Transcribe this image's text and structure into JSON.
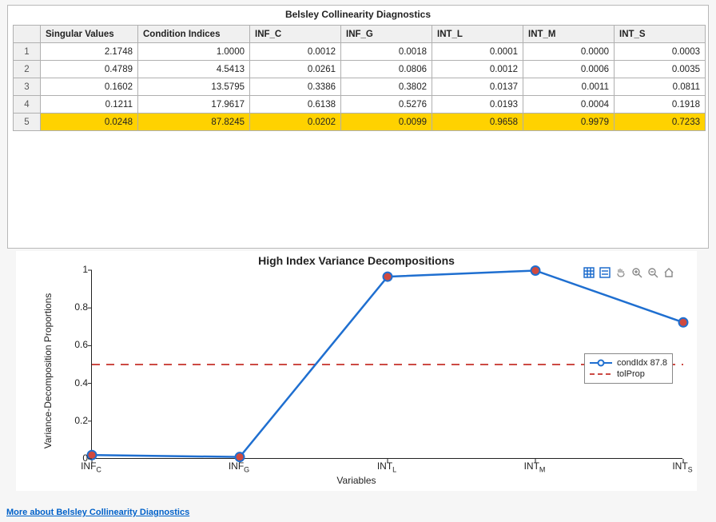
{
  "panel": {
    "title": "Belsley Collinearity Diagnostics"
  },
  "table": {
    "headers": [
      "Singular Values",
      "Condition Indices",
      "INF_C",
      "INF_G",
      "INT_L",
      "INT_M",
      "INT_S"
    ],
    "rows": [
      {
        "n": "1",
        "sv": "2.1748",
        "ci": "1.0000",
        "v": [
          "0.0012",
          "0.0018",
          "0.0001",
          "0.0000",
          "0.0003"
        ],
        "hl": false
      },
      {
        "n": "2",
        "sv": "0.4789",
        "ci": "4.5413",
        "v": [
          "0.0261",
          "0.0806",
          "0.0012",
          "0.0006",
          "0.0035"
        ],
        "hl": false
      },
      {
        "n": "3",
        "sv": "0.1602",
        "ci": "13.5795",
        "v": [
          "0.3386",
          "0.3802",
          "0.0137",
          "0.0011",
          "0.0811"
        ],
        "hl": false
      },
      {
        "n": "4",
        "sv": "0.1211",
        "ci": "17.9617",
        "v": [
          "0.6138",
          "0.5276",
          "0.0193",
          "0.0004",
          "0.1918"
        ],
        "hl": false
      },
      {
        "n": "5",
        "sv": "0.0248",
        "ci": "87.8245",
        "v": [
          "0.0202",
          "0.0099",
          "0.9658",
          "0.9979",
          "0.7233"
        ],
        "hl": true
      }
    ]
  },
  "chart_data": {
    "type": "line",
    "title": "High Index Variance Decompositions",
    "xlabel": "Variables",
    "ylabel": "Variance-Decomposition Proportions",
    "categories": [
      "INF_C",
      "INF_G",
      "INT_L",
      "INT_M",
      "INT_S"
    ],
    "categories_display": [
      {
        "base": "INF",
        "sub": "C"
      },
      {
        "base": "INF",
        "sub": "G"
      },
      {
        "base": "INT",
        "sub": "L"
      },
      {
        "base": "INT",
        "sub": "M"
      },
      {
        "base": "INT",
        "sub": "S"
      }
    ],
    "series": [
      {
        "name": "condIdx 87.8",
        "values": [
          0.0202,
          0.0099,
          0.9658,
          0.9979,
          0.7233
        ],
        "style": "line-marker"
      },
      {
        "name": "tolProp",
        "values": [
          0.5,
          0.5,
          0.5,
          0.5,
          0.5
        ],
        "style": "dashed"
      }
    ],
    "yticks": [
      0,
      0.2,
      0.4,
      0.6,
      0.8,
      1
    ],
    "ylim": [
      0,
      1
    ]
  },
  "legend": {
    "items": [
      {
        "label": "condIdx 87.8",
        "style": "line-marker"
      },
      {
        "label": "tolProp",
        "style": "dashed"
      }
    ]
  },
  "toolbar_icons": [
    "grid-icon",
    "legend-icon",
    "pan-icon",
    "zoom-in-icon",
    "zoom-out-icon",
    "home-icon"
  ],
  "link": "More about Belsley Collinearity Diagnostics"
}
